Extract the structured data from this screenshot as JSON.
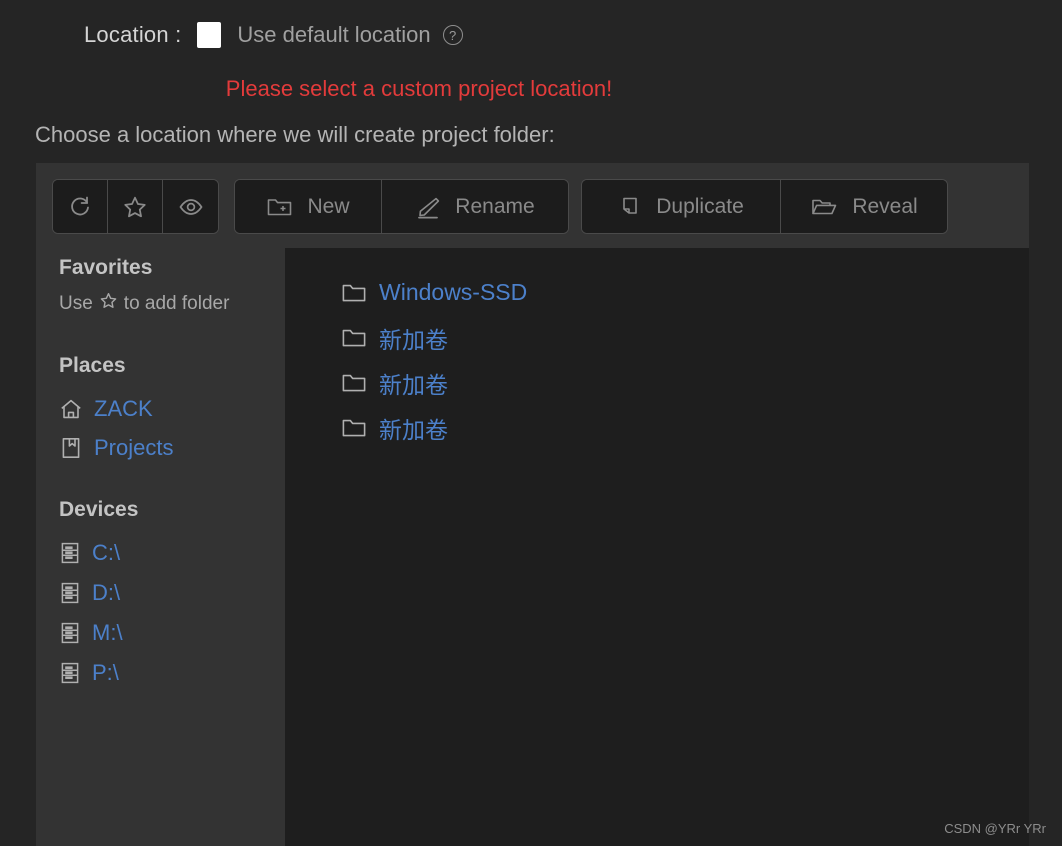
{
  "header": {
    "location_label": "Location :",
    "use_default_label": "Use default location",
    "help_icon": "question-circle-icon",
    "checkbox_checked": false,
    "error_message": "Please select a custom project location!",
    "instruction": "Choose a location where we will create project folder:",
    "error_color": "#e33b3b",
    "link_color": "#4c80ca"
  },
  "toolbar": {
    "groups": [
      {
        "name": "icon-actions",
        "buttons": [
          {
            "label": "",
            "icon": "refresh-icon"
          },
          {
            "label": "",
            "icon": "star-icon"
          },
          {
            "label": "",
            "icon": "eye-icon"
          }
        ]
      },
      {
        "name": "file-actions",
        "buttons": [
          {
            "label": "New",
            "icon": "folder-plus-icon"
          },
          {
            "label": "Rename",
            "icon": "pencil-icon"
          }
        ]
      },
      {
        "name": "extra-actions",
        "buttons": [
          {
            "label": "Duplicate",
            "icon": "copy-icon"
          },
          {
            "label": "Reveal",
            "icon": "folder-open-icon"
          }
        ]
      }
    ]
  },
  "sidebar": {
    "favorites": {
      "title": "Favorites",
      "hint_before": "Use",
      "hint_icon": "star-icon",
      "hint_after": "to add folder"
    },
    "places": {
      "title": "Places",
      "items": [
        {
          "label": "ZACK",
          "icon": "home-icon"
        },
        {
          "label": "Projects",
          "icon": "bookmark-icon"
        }
      ]
    },
    "devices": {
      "title": "Devices",
      "items": [
        {
          "label": "C:\\",
          "icon": "drive-icon"
        },
        {
          "label": "D:\\",
          "icon": "drive-icon"
        },
        {
          "label": "M:\\",
          "icon": "drive-icon"
        },
        {
          "label": "P:\\",
          "icon": "drive-icon"
        }
      ]
    }
  },
  "filelist": {
    "items": [
      {
        "name": "Windows-SSD",
        "icon": "folder-icon"
      },
      {
        "name": "新加卷",
        "icon": "folder-icon"
      },
      {
        "name": "新加卷",
        "icon": "folder-icon"
      },
      {
        "name": "新加卷",
        "icon": "folder-icon"
      }
    ]
  },
  "watermark": {
    "text": "CSDN @YRr YRr"
  }
}
